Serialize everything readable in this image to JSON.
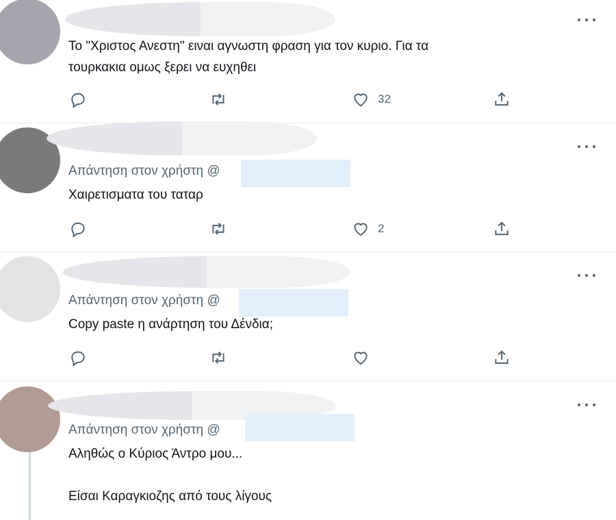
{
  "tweets": [
    {
      "text_lines": [
        "Το \"Χριστος Ανεστη\" ειναι αγνωστη φραση για τον κυριο. Για τα",
        "τουρκακια ομως ξερει να ευχηθει"
      ],
      "likes": "32",
      "avatar_color": "#a5a6ad"
    },
    {
      "reply_to": "Απάντηση στον χρήστη @",
      "text_lines": [
        "Χαιρετισματα του ταταρ"
      ],
      "likes": "2",
      "avatar_color": "#7a7a7a"
    },
    {
      "reply_to": "Απάντηση στον χρήστη @",
      "text_lines": [
        "Copy paste η ανάρτηση του Δένδια;"
      ],
      "likes": "",
      "avatar_color": "#e3e3e3"
    },
    {
      "reply_to": "Απάντηση στον χρήστη @",
      "text_lines": [
        "Αληθώς ο Κύριος Άντρο μου...",
        "",
        "Είσαι Καραγκιοζης από τους λίγους"
      ],
      "avatar_color": "#b09c94"
    }
  ],
  "icons": {
    "reply": "reply-icon",
    "retweet": "retweet-icon",
    "like": "heart-icon",
    "share": "share-icon",
    "more": "more-icon"
  },
  "colors": {
    "icon": "#536471",
    "text": "#0f1419",
    "secondary": "#536471",
    "divider": "#e6ecf0",
    "handle_highlight": "#e3effb"
  }
}
